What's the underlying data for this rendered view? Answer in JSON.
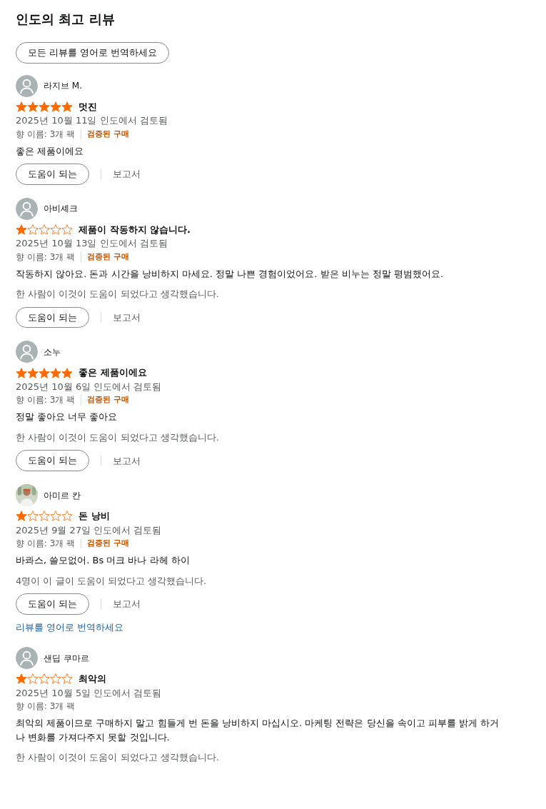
{
  "heading": "인도의 최고 리뷰",
  "translate_all_button": "모든 리뷰를 영어로 번역하세요",
  "reviews": [
    {
      "reviewer": "라지브 M.",
      "avatar": {
        "kind": "default"
      },
      "stars": 5,
      "title": "멋진",
      "date": "2025년 10월 11일 인도에서 검토됨",
      "variant": "향 이름: 3개 팩",
      "verified": "검증된 구매",
      "body": "좋은 제품이에요",
      "helpful_button": "도움이 되는",
      "report_link": "보고서"
    },
    {
      "reviewer": "아비셰크",
      "avatar": {
        "kind": "default"
      },
      "stars": 1,
      "title": "제품이 작동하지 않습니다.",
      "date": "2025년 10월 13일 인도에서 검토됨",
      "variant": "향 이름: 3개 팩",
      "verified": "검증된 구매",
      "body": "작동하지 않아요. 돈과 시간을 낭비하지 마세요. 정말 나쁜 경험이었어요. 받은 비누는 정말 평범했어요.",
      "helpful_count": "한 사람이 이것이 도움이 되었다고 생각했습니다.",
      "helpful_button": "도움이 되는",
      "report_link": "보고서"
    },
    {
      "reviewer": "소누",
      "avatar": {
        "kind": "default"
      },
      "stars": 5,
      "title": "좋은 제품이에요",
      "date": "2025년 10월 6일 인도에서 검토됨",
      "variant": "향 이름: 3개 팩",
      "verified": "검증된 구매",
      "body": "정말 좋아요 너무 좋아요",
      "helpful_count": "한 사람이 이것이 도움이 되었다고 생각했습니다.",
      "helpful_button": "도움이 되는",
      "report_link": "보고서"
    },
    {
      "reviewer": "아미르 칸",
      "stars": 1,
      "title": "돈 낭비",
      "date": "2025년 9월 27일 인도에서 검토됨",
      "variant": "향 이름: 3개 팩",
      "verified": "검증된 구매",
      "body": "바콰스, 쓸모없어. Bs 머크 바나 라헤 하이",
      "helpful_count": "4명이 이 글이 도움이 되었다고 생각했습니다.",
      "helpful_button": "도움이 되는",
      "report_link": "보고서",
      "translate_link": "리뷰를 영어로 번역하세요"
    },
    {
      "reviewer": "샌딥 쿠마르",
      "avatar": {
        "kind": "default"
      },
      "stars": 1,
      "title": "최악의",
      "date": "2025년 10월 5일 인도에서 검토됨",
      "variant": "향 이름: 3개 팩",
      "body": "최악의 제품이므로 구매하지 말고 힘들게 번 돈을 낭비하지 마십시오. 마케팅 전략은 당신을 속이고 피부를 밝게 하거나 변화를 가져다주지 못할 것입니다.",
      "helpful_count": "한 사람이 이것이 도움이 되었다고 생각했습니다."
    }
  ]
}
